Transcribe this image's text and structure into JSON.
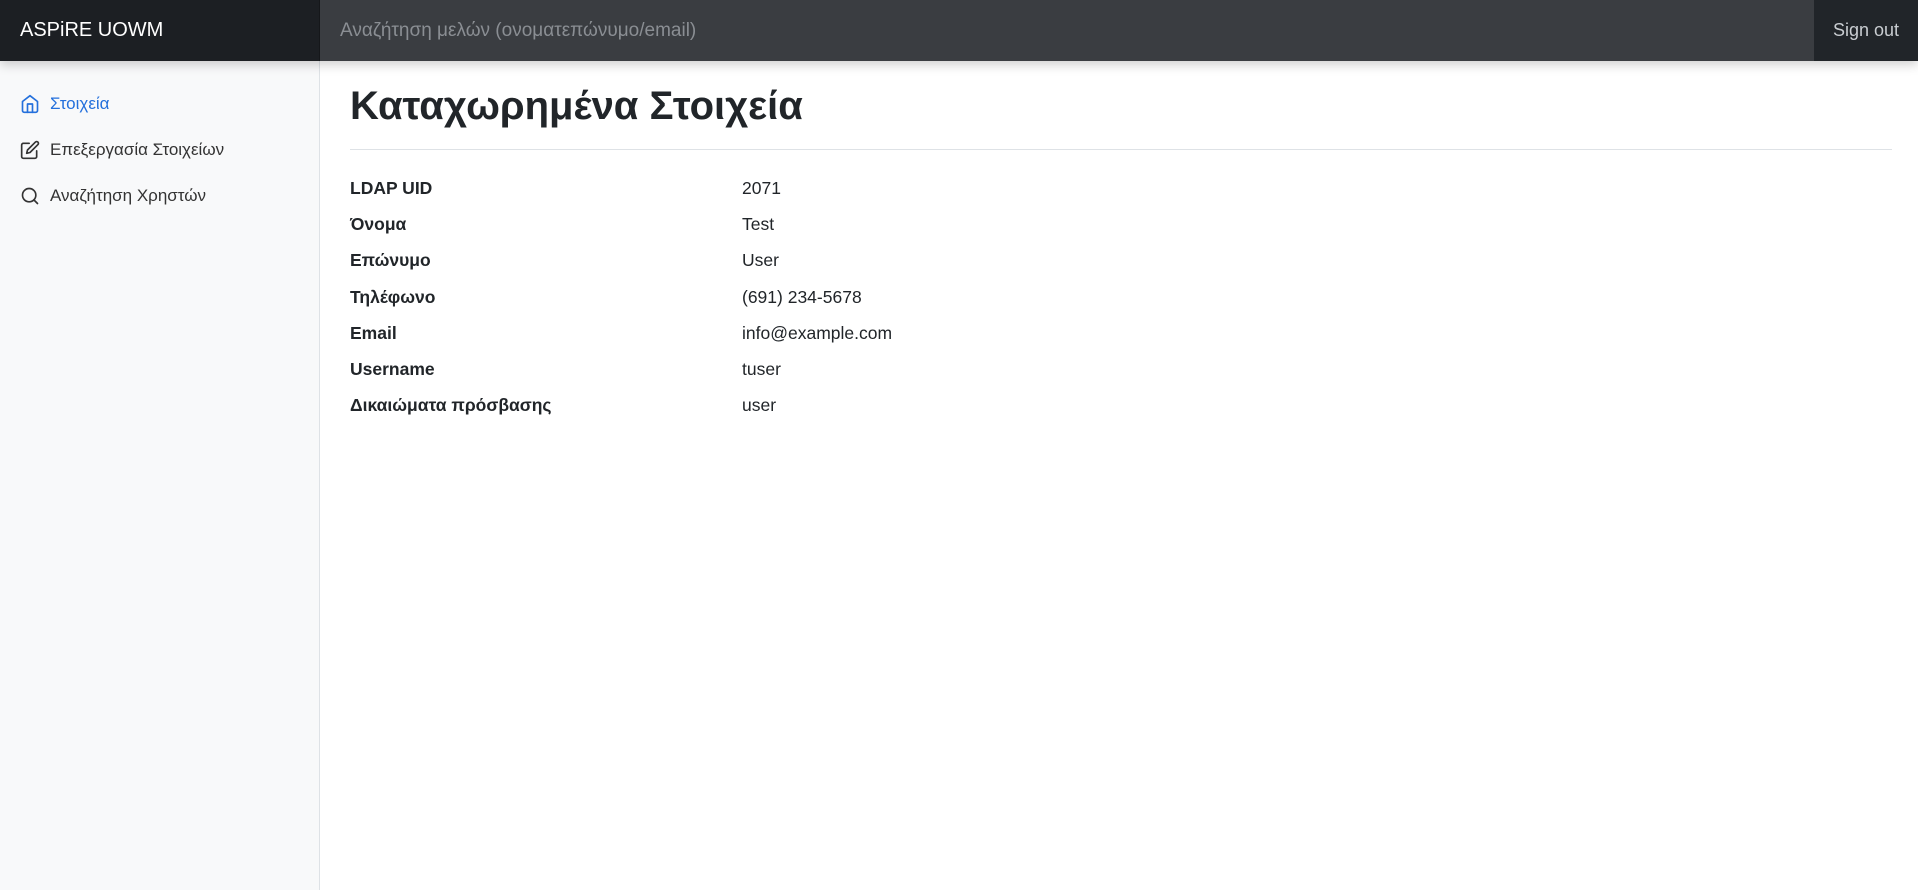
{
  "app": {
    "brand": "ASPiRE UOWM"
  },
  "header": {
    "search_placeholder": "Αναζήτηση μελών (ονοματεπώνυμο/email)",
    "signout_label": "Sign out"
  },
  "sidebar": {
    "items": [
      {
        "label": "Στοιχεία",
        "icon": "home-icon",
        "active": true
      },
      {
        "label": "Επεξεργασία Στοιχείων",
        "icon": "edit-icon",
        "active": false
      },
      {
        "label": "Αναζήτηση Χρηστών",
        "icon": "search-icon",
        "active": false
      }
    ]
  },
  "main": {
    "title": "Καταχωρημένα Στοιχεία",
    "fields": [
      {
        "label": "LDAP UID",
        "value": "2071"
      },
      {
        "label": "Όνομα",
        "value": "Test"
      },
      {
        "label": "Επώνυμο",
        "value": "User"
      },
      {
        "label": "Τηλέφωνο",
        "value": "(691) 234-5678"
      },
      {
        "label": "Email",
        "value": "info@example.com"
      },
      {
        "label": "Username",
        "value": "tuser"
      },
      {
        "label": "Δικαιώματα πρόσβασης",
        "value": "user"
      }
    ]
  },
  "colors": {
    "navbar": "#212529",
    "accent": "#2470dc",
    "sidebar_bg": "#f8f9fa"
  }
}
